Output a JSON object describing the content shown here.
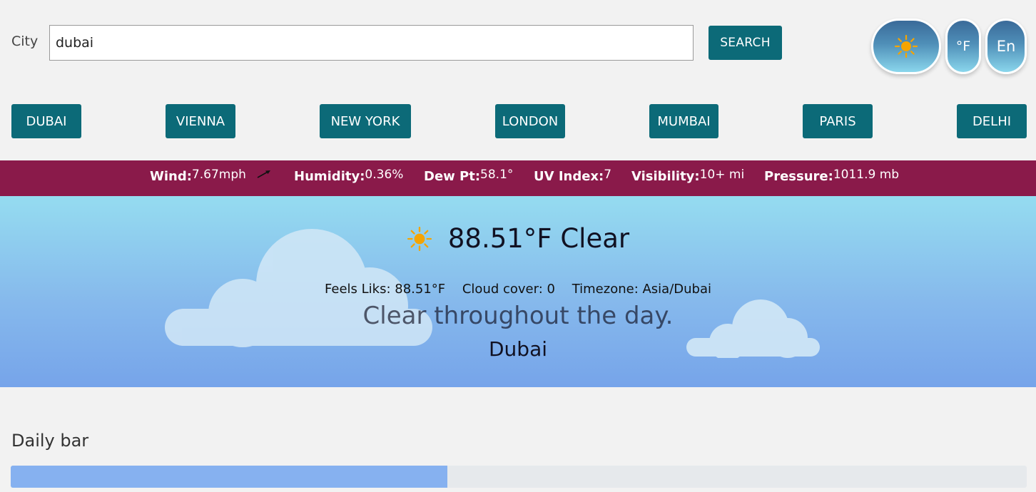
{
  "search": {
    "label": "City",
    "value": "dubai",
    "button_label": "SEARCH"
  },
  "toggles": {
    "theme_icon": "sun-icon",
    "unit_label": "°F",
    "lang_label": "En"
  },
  "cities": [
    "DUBAI",
    "VIENNA",
    "NEW YORK",
    "LONDON",
    "MUMBAI",
    "PARIS",
    "DELHI"
  ],
  "stats": {
    "wind_label": "Wind:",
    "wind_value": "7.67mph",
    "humidity_label": "Humidity:",
    "humidity_value": "0.36%",
    "dew_label": "Dew Pt:",
    "dew_value": "58.1°",
    "uv_label": "UV Index:",
    "uv_value": "7",
    "visibility_label": "Visibility:",
    "visibility_value": "10+ mi",
    "pressure_label": "Pressure:",
    "pressure_value": "1011.9 mb"
  },
  "weather": {
    "icon": "sun-icon",
    "headline": "88.51°F Clear",
    "feels_like": "Feels Liks: 88.51°F",
    "cloud_cover": "Cloud cover: 0",
    "timezone": "Timezone: Asia/Dubai",
    "summary": "Clear throughout the day.",
    "city": "Dubai"
  },
  "daily": {
    "title": "Daily bar",
    "progress_fraction": 0.43
  },
  "colors": {
    "button": "#0c6a78",
    "stats_bar": "#8a1a4a",
    "sun": "#f5a400",
    "daily_fill": "#86b1f0"
  }
}
